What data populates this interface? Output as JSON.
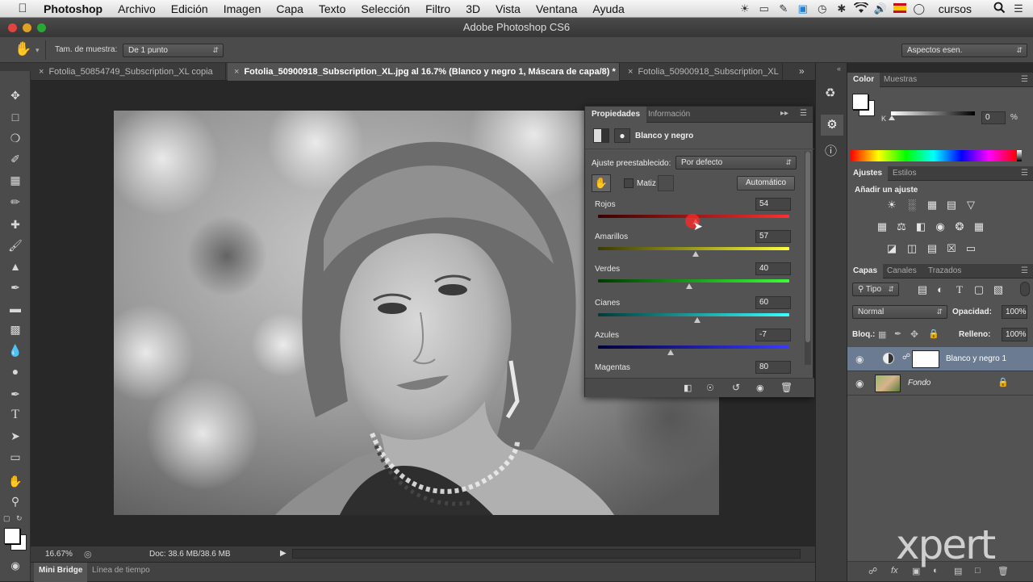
{
  "menubar": {
    "app": "Photoshop",
    "items": [
      "Archivo",
      "Edición",
      "Imagen",
      "Capa",
      "Texto",
      "Selección",
      "Filtro",
      "3D",
      "Vista",
      "Ventana",
      "Ayuda"
    ],
    "user": "cursos"
  },
  "window": {
    "title": "Adobe Photoshop CS6"
  },
  "options": {
    "sample_label": "Tam. de muestra:",
    "sample_value": "De 1 punto",
    "workspace": "Aspectos esen."
  },
  "tabs": [
    {
      "label": "Fotolia_50854749_Subscription_XL copia"
    },
    {
      "label": "Fotolia_50900918_Subscription_XL.jpg al 16.7% (Blanco y negro 1, Máscara de capa/8) *"
    },
    {
      "label": "Fotolia_50900918_Subscription_XL"
    }
  ],
  "status": {
    "zoom": "16.67%",
    "doc": "Doc: 38.6 MB/38.6 MB"
  },
  "bottom_tabs": [
    "Mini Bridge",
    "Línea de tiempo"
  ],
  "properties": {
    "tabs": [
      "Propiedades",
      "Información"
    ],
    "adjustment_name": "Blanco y negro",
    "preset_label": "Ajuste preestablecido:",
    "preset_value": "Por defecto",
    "tint_label": "Matiz",
    "auto_button": "Automático",
    "sliders": [
      {
        "label": "Rojos",
        "value": "54",
        "fraction": 0.51
      },
      {
        "label": "Amarillos",
        "value": "57",
        "fraction": 0.51
      },
      {
        "label": "Verdes",
        "value": "40",
        "fraction": 0.475
      },
      {
        "label": "Cianes",
        "value": "60",
        "fraction": 0.52
      },
      {
        "label": "Azules",
        "value": "-7",
        "fraction": 0.38
      },
      {
        "label": "Magentas",
        "value": "80"
      }
    ]
  },
  "color_panel": {
    "tabs": [
      "Color",
      "Muestras"
    ],
    "channel": "K",
    "value": "0",
    "unit": "%"
  },
  "adjustments_panel": {
    "tabs": [
      "Ajustes",
      "Estilos"
    ],
    "heading": "Añadir un ajuste"
  },
  "layers_panel": {
    "tabs": [
      "Capas",
      "Canales",
      "Trazados"
    ],
    "filter": "Tipo",
    "blend_mode": "Normal",
    "opacity_label": "Opacidad:",
    "opacity_value": "100%",
    "lock_label": "Bloq.:",
    "fill_label": "Relleno:",
    "fill_value": "100%",
    "layers": [
      {
        "name": "Blanco y negro 1"
      },
      {
        "name": "Fondo"
      }
    ]
  },
  "watermark": "xpert"
}
